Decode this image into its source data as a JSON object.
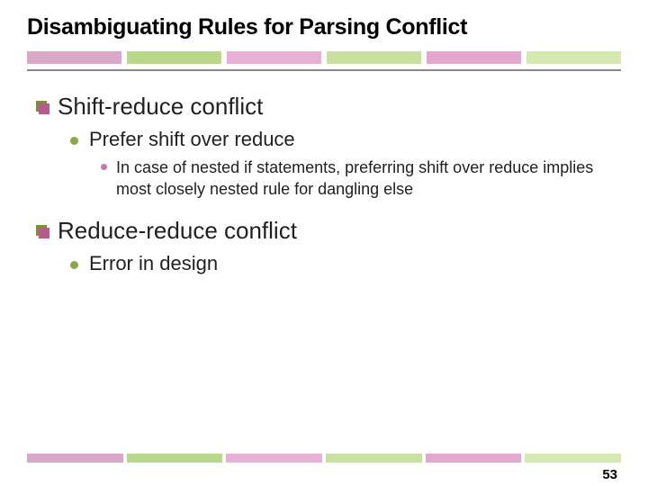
{
  "title": "Disambiguating Rules for Parsing Conflict",
  "sections": [
    {
      "heading": "Shift-reduce conflict",
      "sub": [
        {
          "text": "Prefer shift over reduce",
          "sub": [
            {
              "text": "In case of nested if statements, preferring shift over reduce implies most closely nested rule for dangling else"
            }
          ]
        }
      ]
    },
    {
      "heading": "Reduce-reduce conflict",
      "sub": [
        {
          "text": "Error in design",
          "sub": []
        }
      ]
    }
  ],
  "page_number": "53"
}
